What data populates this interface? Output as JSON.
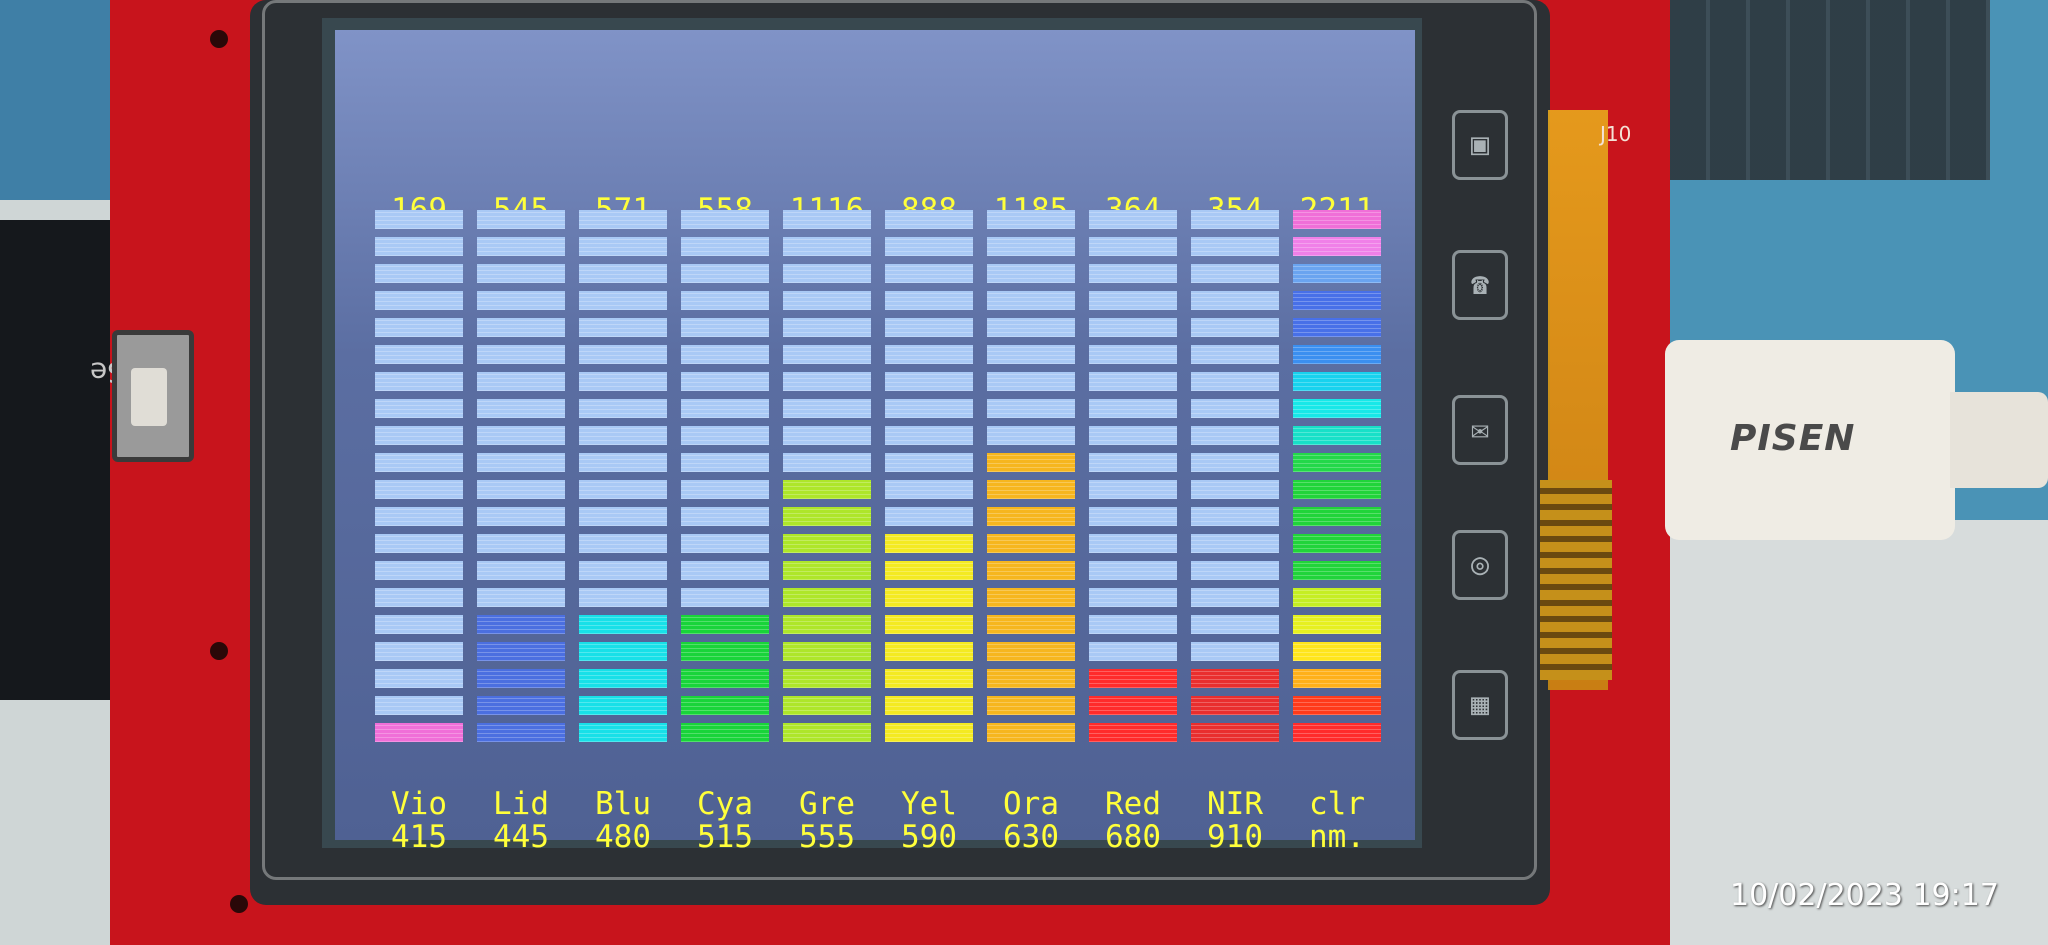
{
  "device": {
    "connector_label": "J10",
    "usb_brand": "PISEN",
    "chip_text": "lor Se",
    "timestamp": "10/02/2023  19:17",
    "side_icons": [
      "camera-icon",
      "phone-icon",
      "mail-icon",
      "settings-icon",
      "keypad-icon"
    ]
  },
  "screen": {
    "background": "#5b6ea2",
    "text_color": "#ffff3a",
    "total_segments": 20,
    "inactive_color": "#a9c9f5"
  },
  "channels": [
    {
      "value": "169",
      "name": "Vio",
      "wavelength": "415",
      "lit": 1,
      "colors": [
        "#f06fd8"
      ]
    },
    {
      "value": "545",
      "name": "Lid",
      "wavelength": "445",
      "lit": 5,
      "colors": [
        "#4b6fe0"
      ]
    },
    {
      "value": "571",
      "name": "Blu",
      "wavelength": "480",
      "lit": 5,
      "colors": [
        "#18e0e8"
      ]
    },
    {
      "value": "558",
      "name": "Cya",
      "wavelength": "515",
      "lit": 5,
      "colors": [
        "#19d43a"
      ]
    },
    {
      "value": "1116",
      "name": "Gre",
      "wavelength": "555",
      "lit": 10,
      "colors": [
        "#aee62a"
      ]
    },
    {
      "value": "888",
      "name": "Yel",
      "wavelength": "590",
      "lit": 8,
      "colors": [
        "#f4ea22"
      ]
    },
    {
      "value": "1185",
      "name": "Ora",
      "wavelength": "630",
      "lit": 11,
      "colors": [
        "#f6b61e"
      ]
    },
    {
      "value": "364",
      "name": "Red",
      "wavelength": "680",
      "lit": 3,
      "colors": [
        "#ff2b2b"
      ]
    },
    {
      "value": "354",
      "name": "NIR",
      "wavelength": "910",
      "lit": 3,
      "colors": [
        "#e92e2e"
      ]
    },
    {
      "value": "2211",
      "name": "clr",
      "wavelength": "nm.",
      "lit": 20,
      "colors": [
        "#ff2b2b",
        "#ff3a1a",
        "#ffb01a",
        "#ffe51c",
        "#e6f020",
        "#c5ee24",
        "#21d43a",
        "#21d43a",
        "#21d43a",
        "#21d43a",
        "#23d84a",
        "#18e0c8",
        "#18e8e8",
        "#18d2ee",
        "#3b8ff0",
        "#4870e8",
        "#4870e8",
        "#6aa4f0",
        "#f080e8",
        "#f06fd8"
      ]
    }
  ]
}
